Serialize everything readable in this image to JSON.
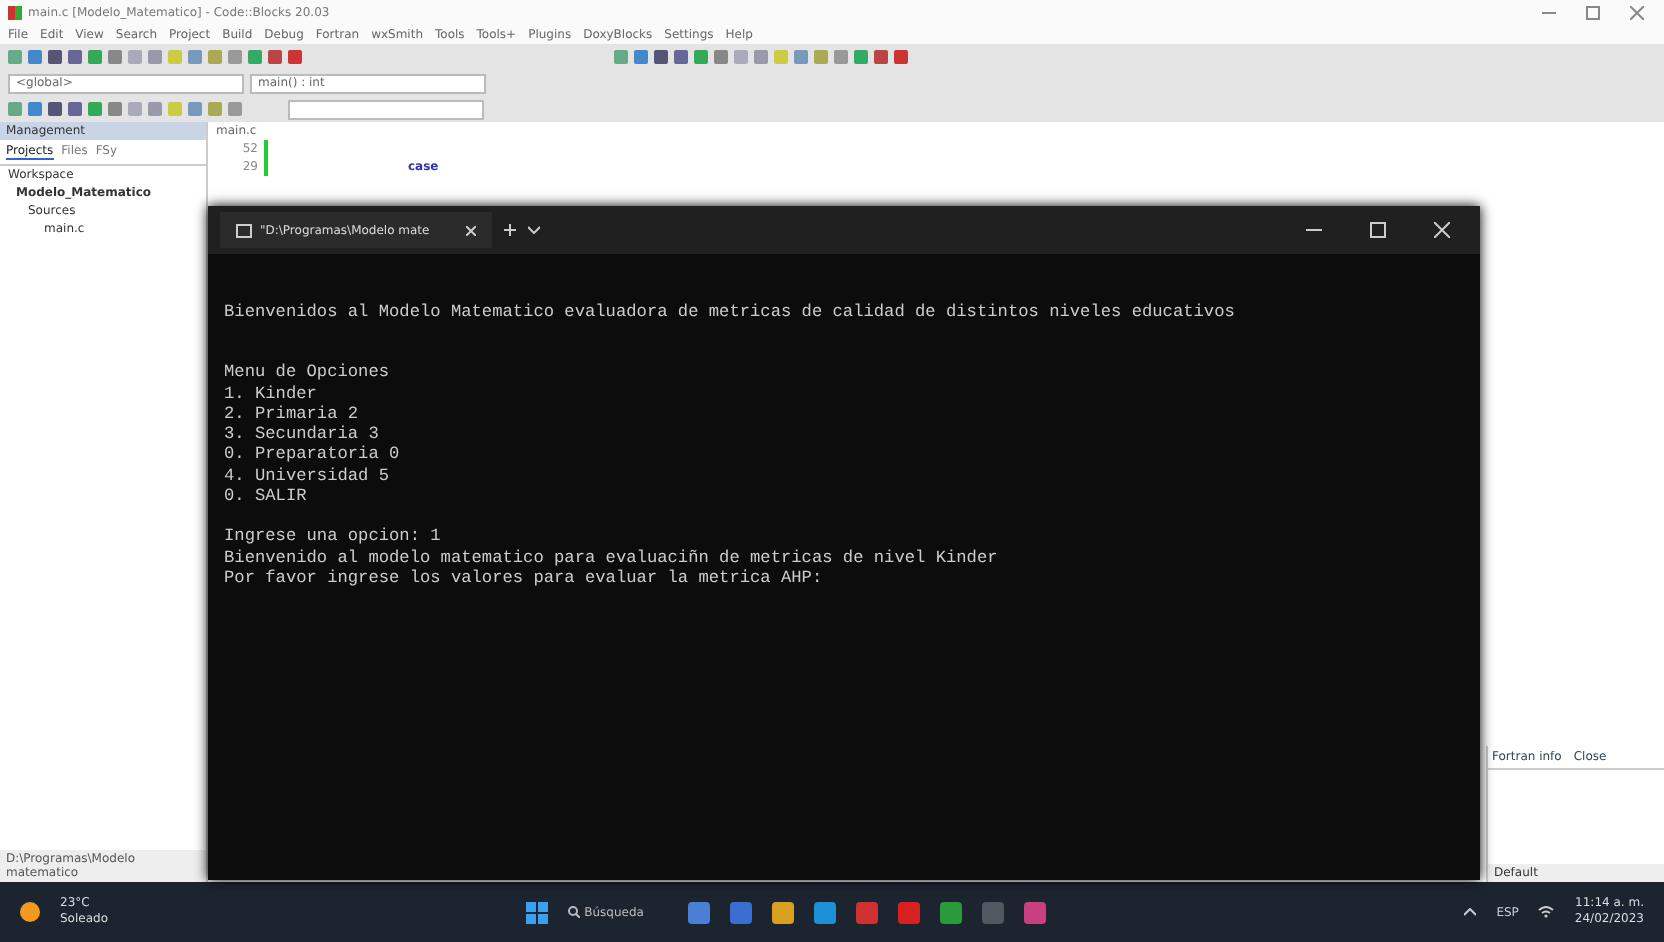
{
  "ide": {
    "title": "main.c [Modelo_Matematico] - Code::Blocks 20.03",
    "menu": [
      "File",
      "Edit",
      "View",
      "Search",
      "Project",
      "Build",
      "Debug",
      "Fortran",
      "wxSmith",
      "Tools",
      "Tools+",
      "Plugins",
      "DoxyBlocks",
      "Settings",
      "Help"
    ],
    "scope": "<global>",
    "symbol": "main() : int",
    "management": {
      "title": "Management",
      "tabs": [
        {
          "label": "Projects",
          "selected": true
        },
        {
          "label": "Files",
          "selected": false
        },
        {
          "label": "FSy",
          "selected": false
        }
      ],
      "tree": [
        {
          "label": "Workspace",
          "children": [
            {
              "label": "Modelo_Matematico",
              "children": [
                {
                  "label": "Sources",
                  "children": [
                    {
                      "label": "main.c"
                    }
                  ]
                }
              ]
            }
          ]
        }
      ]
    },
    "editor_tab": "main.c",
    "line_numbers": [
      "52",
      "29"
    ],
    "code": "case",
    "log_tabs": [
      "Fortran info",
      "Close"
    ],
    "status": "D:\\Programas\\Modelo matematico",
    "status_right": "Default"
  },
  "terminal": {
    "tab_title": "\"D:\\Programas\\Modelo mate",
    "blocks": [
      {
        "lines": [
          "Bienvenidos al Modelo Matematico evaluadora de metricas de calidad de distintos niveles educativos"
        ]
      },
      {
        "lines": [
          "Menu de Opciones",
          "1. Kinder",
          "2. Primaria 2",
          "3. Secundaria 3",
          "0. Preparatoria 0",
          "4. Universidad 5",
          "0. SALIR"
        ]
      },
      {
        "lines": [
          "Ingrese una opcion: 1",
          "Bienvenido al modelo matematico para evaluaciñn de metricas de nivel Kinder",
          "Por favor ingrese los valores para evaluar la metrica AHP:"
        ]
      }
    ]
  },
  "taskbar": {
    "weather": "23°C",
    "weather_label": "Soleado",
    "search": "Búsqueda",
    "language": "ESP",
    "time": "11:14 a. m.",
    "date": "24/02/2023"
  }
}
